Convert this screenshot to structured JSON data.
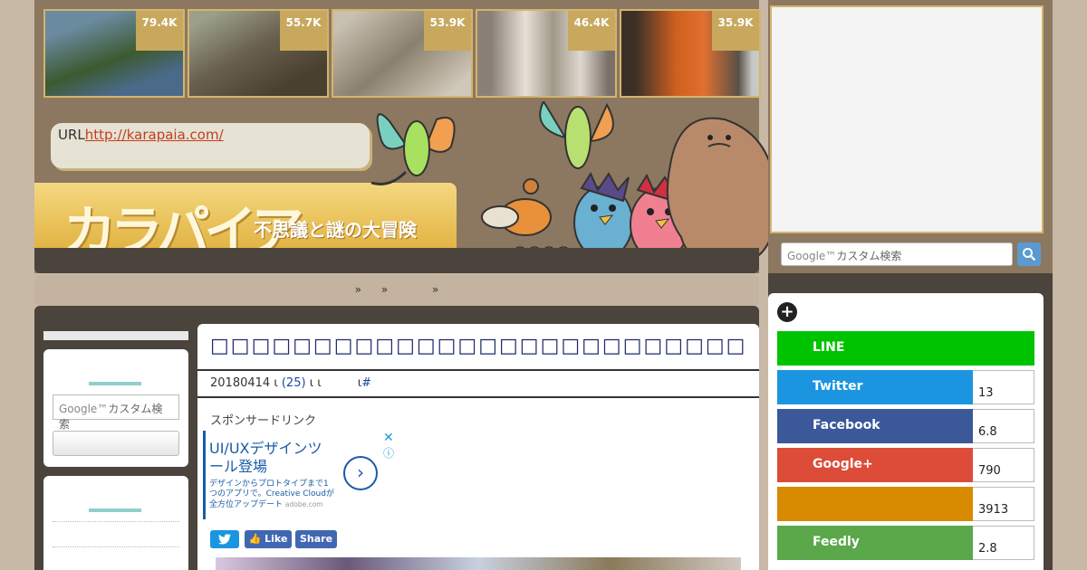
{
  "header": {
    "thumbs": [
      {
        "count": "79.4K",
        "colors": [
          "#5c7a90",
          "#3c5a30"
        ]
      },
      {
        "count": "55.7K",
        "colors": [
          "#7a8a6a",
          "#4a4030"
        ]
      },
      {
        "count": "53.9K",
        "colors": [
          "#b8b0a0",
          "#6a6050"
        ]
      },
      {
        "count": "46.4K",
        "colors": [
          "#8a8078",
          "#c8c0b8"
        ]
      },
      {
        "count": "35.9K",
        "colors": [
          "#d06020",
          "#3a3028"
        ]
      }
    ],
    "url_label": "URL",
    "url_link": "http://karapaia.com/",
    "logo": "カラパイア",
    "tagline": "不思議と謎の大冒険"
  },
  "nav": {
    "items": [
      "»",
      "»",
      "»"
    ]
  },
  "left": {
    "search_placeholder": "Googleカスタム検索",
    "google_word": "Google™",
    "search_suffix": "カスタム検索"
  },
  "article": {
    "title": "□□□□□□□□□□□□□□□□□□□□□□□□□□□□□□□□□",
    "date": "20180414",
    "sep1": "ι",
    "comments": "(25)",
    "sep2": "ι ι",
    "sep3": "ι",
    "hash": "#",
    "sponsor": "スポンサードリンク",
    "ad": {
      "headline": "UI/UXデザインツール登場",
      "sub": "デザインからプロトタイプまで1つのアプリで。Creative Cloudが全方位アップデート",
      "domain": "adobe.com",
      "close": "✕",
      "info": "ⓘ",
      "arrow": "›"
    },
    "share": {
      "like": "Like",
      "share": "Share",
      "tw": "t"
    }
  },
  "right": {
    "search_google": "Google™",
    "search_suffix": "カスタム検索",
    "search_btn": "🔍",
    "plus": "+",
    "rows": [
      {
        "label": "LINE",
        "count": "",
        "color": "#00c300"
      },
      {
        "label": "Twitter",
        "count": "13",
        "color": "#1b95e0"
      },
      {
        "label": "Facebook",
        "count": "6.8",
        "color": "#3b5998"
      },
      {
        "label": "Google+",
        "count": "790",
        "color": "#dd4b39"
      },
      {
        "label": "",
        "count": "3913",
        "color": "#d88a00"
      },
      {
        "label": "Feedly",
        "count": "2.8",
        "color": "#5aa84a"
      }
    ]
  }
}
